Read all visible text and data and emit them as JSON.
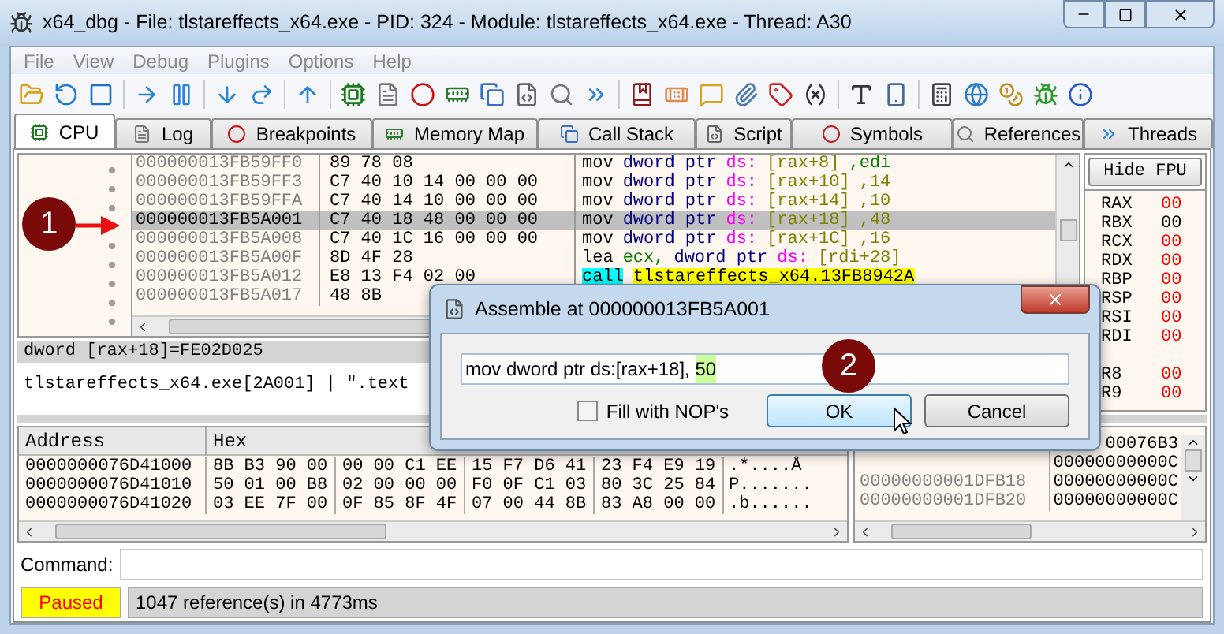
{
  "window": {
    "title": "x64_dbg - File: tlstareffects_x64.exe - PID: 324 - Module: tlstareffects_x64.exe - Thread: A30"
  },
  "menu": [
    "File",
    "View",
    "Debug",
    "Plugins",
    "Options",
    "Help"
  ],
  "tabs": [
    {
      "label": "CPU",
      "selected": true
    },
    {
      "label": "Log",
      "selected": false
    },
    {
      "label": "Breakpoints",
      "selected": false
    },
    {
      "label": "Memory Map",
      "selected": false
    },
    {
      "label": "Call Stack",
      "selected": false
    },
    {
      "label": "Script",
      "selected": false
    },
    {
      "label": "Symbols",
      "selected": false
    },
    {
      "label": "References",
      "selected": false
    },
    {
      "label": "Threads",
      "selected": false
    }
  ],
  "disassembly": {
    "rows": [
      {
        "address": "000000013FB59FF0",
        "bytes": "89 78 08",
        "selected": false,
        "instruction": [
          {
            "text": "mov",
            "color": "#000000"
          },
          {
            "text": "dword ptr",
            "color": "#000080"
          },
          {
            "text": "ds:",
            "color": "#ff00ff"
          },
          {
            "text": "[rax+8]",
            "color": "#808000"
          },
          {
            "text": ",edi",
            "color": "#008000"
          }
        ]
      },
      {
        "address": "000000013FB59FF3",
        "bytes": "C7 40 10 14 00 00 00",
        "selected": false,
        "instruction": [
          {
            "text": "mov",
            "color": "#000000"
          },
          {
            "text": "dword ptr",
            "color": "#000080"
          },
          {
            "text": "ds:",
            "color": "#ff00ff"
          },
          {
            "text": "[rax+10]",
            "color": "#808000"
          },
          {
            "text": ",14",
            "color": "#808000"
          }
        ]
      },
      {
        "address": "000000013FB59FFA",
        "bytes": "C7 40 14 10 00 00 00",
        "selected": false,
        "instruction": [
          {
            "text": "mov",
            "color": "#000000"
          },
          {
            "text": "dword ptr",
            "color": "#000080"
          },
          {
            "text": "ds:",
            "color": "#ff00ff"
          },
          {
            "text": "[rax+14]",
            "color": "#808000"
          },
          {
            "text": ",10",
            "color": "#808000"
          }
        ]
      },
      {
        "address": "000000013FB5A001",
        "bytes": "C7 40 18 48 00 00 00",
        "selected": true,
        "instruction": [
          {
            "text": "mov",
            "color": "#000000"
          },
          {
            "text": "dword ptr",
            "color": "#000080"
          },
          {
            "text": "ds:",
            "color": "#ff00ff"
          },
          {
            "text": "[rax+18]",
            "color": "#808000"
          },
          {
            "text": ",48",
            "color": "#808000"
          }
        ]
      },
      {
        "address": "000000013FB5A008",
        "bytes": "C7 40 1C 16 00 00 00",
        "selected": false,
        "instruction": [
          {
            "text": "mov",
            "color": "#000000"
          },
          {
            "text": "dword ptr",
            "color": "#000080"
          },
          {
            "text": "ds:",
            "color": "#ff00ff"
          },
          {
            "text": "[rax+1C]",
            "color": "#808000"
          },
          {
            "text": ",16",
            "color": "#808000"
          }
        ]
      },
      {
        "address": "000000013FB5A00F",
        "bytes": "8D 4F 28",
        "selected": false,
        "instruction": [
          {
            "text": "lea",
            "color": "#000000"
          },
          {
            "text": "ecx,",
            "color": "#008000"
          },
          {
            "text": "dword ptr",
            "color": "#000080"
          },
          {
            "text": "ds:",
            "color": "#ff00ff"
          },
          {
            "text": "[rdi+28]",
            "color": "#808000"
          }
        ]
      },
      {
        "address": "000000013FB5A012",
        "bytes": "E8 13 F4 02 00",
        "selected": false,
        "instruction": [
          {
            "text": "call",
            "kind": "highlighted",
            "color": "#00ffff"
          },
          {
            "text": "tlstareffects_x64.13FB8942A",
            "kind": "highlighted",
            "color": "#ffff00"
          }
        ]
      },
      {
        "address": "000000013FB5A017",
        "bytes": "48 8B",
        "selected": false,
        "instruction": []
      }
    ]
  },
  "registers": {
    "button": "Hide FPU",
    "items": [
      {
        "name": "RAX",
        "value": "00",
        "changed": true
      },
      {
        "name": "RBX",
        "value": "00",
        "changed": false
      },
      {
        "name": "RCX",
        "value": "00",
        "changed": true
      },
      {
        "name": "RDX",
        "value": "00",
        "changed": true
      },
      {
        "name": "RBP",
        "value": "00",
        "changed": true
      },
      {
        "name": "RSP",
        "value": "00",
        "changed": true
      },
      {
        "name": "RSI",
        "value": "00",
        "changed": true
      },
      {
        "name": "RDI",
        "value": "00",
        "changed": true
      },
      {
        "name": "R8",
        "value": "00",
        "changed": true
      },
      {
        "name": "R9",
        "value": "00",
        "changed": true
      }
    ]
  },
  "info": {
    "line_1": "dword [rax+18]=FE02D025",
    "line_2": "tlstareffects_x64.exe[2A001] | \".text"
  },
  "dump": {
    "columns": [
      "Address",
      "Hex"
    ],
    "rows": [
      {
        "address": "0000000076D41000",
        "hex": [
          "8B B3 90 00",
          "00 00 C1 EE",
          "15 F7 D6 41",
          "23 F4 E9 19"
        ],
        "ascii": ".*....Å"
      },
      {
        "address": "0000000076D41010",
        "hex": [
          "50 01 00 B8",
          "02 00 00 00",
          "F0 0F C1 03",
          "80 3C 25 84"
        ],
        "ascii": "P......."
      },
      {
        "address": "0000000076D41020",
        "hex": [
          "03 EE 7F 00",
          "0F 85 8F 4F",
          "07 00 44 8B",
          "83 A8 00 00"
        ],
        "ascii": ".b......"
      }
    ]
  },
  "stack": {
    "rows": [
      {
        "value": "00076B3"
      },
      {
        "value": "00000000000C"
      },
      {
        "address": "00000000001DFB18",
        "value": "00000000000C"
      },
      {
        "address": "00000000001DFB20",
        "value": "00000000000C"
      }
    ]
  },
  "command": {
    "label": "Command:"
  },
  "status_bar": {
    "state": "Paused",
    "message": "1047 reference(s) in 4773ms"
  },
  "dialog": {
    "title": "Assemble at 000000013FB5A001",
    "value": "mov dword ptr ds:[rax+18],",
    "selected_text": "50",
    "fill_with_nops": {
      "label": "Fill with NOP's",
      "checked": false
    },
    "buttons": [
      "OK",
      "Cancel"
    ]
  },
  "annotations": [
    "1",
    "2"
  ]
}
